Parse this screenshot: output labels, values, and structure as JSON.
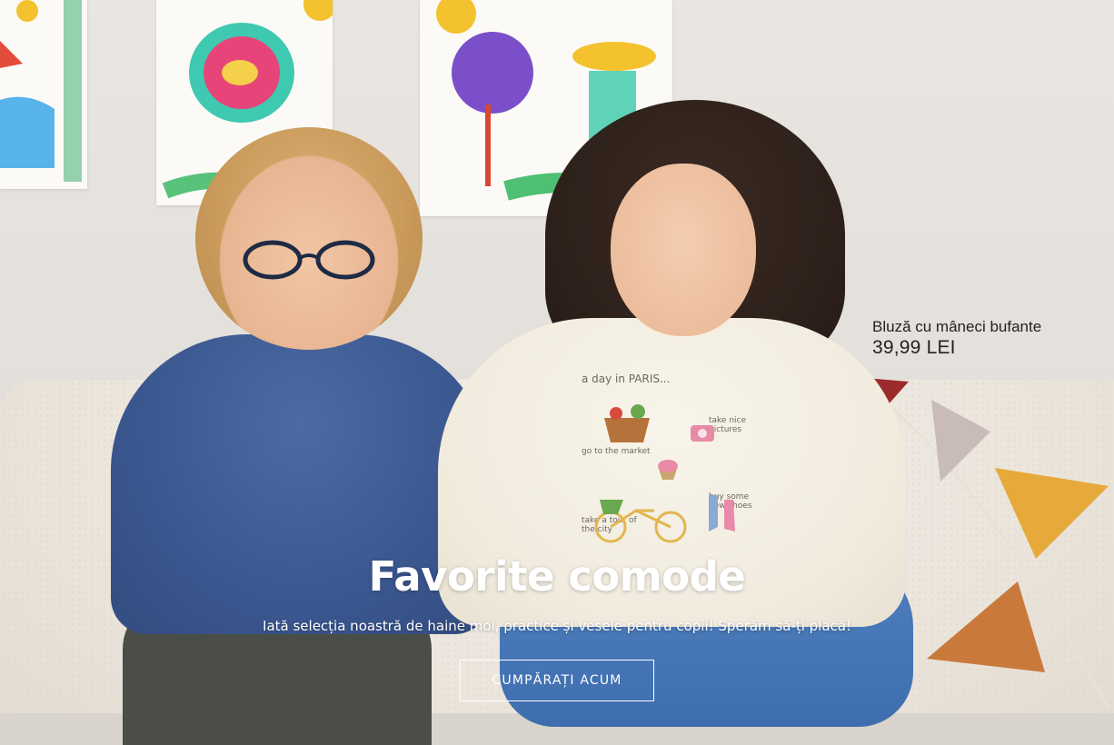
{
  "product_tag": {
    "name": "Bluză cu mâneci bufante",
    "price": "39,99 LEI"
  },
  "promo": {
    "title": "Favorite comode",
    "subtitle": "Iată selecția noastră de haine moi, practice și vesele pentru copii! Sperăm să-ți placă!",
    "cta_label": "CUMPĂRAȚI ACUM"
  },
  "sweater_print": {
    "heading": "a day in PARIS...",
    "items": [
      "go to the market",
      "take nice pictures",
      "buy some new shoes",
      "take a tour of the city"
    ]
  },
  "colors": {
    "boy_sweater": "#3b5790",
    "girl_sweater": "#f1ebde",
    "jeans": "#4f7fbf",
    "sofa": "#ebe5dc",
    "wall": "#e6e1dd",
    "cta_border": "#ffffff"
  }
}
